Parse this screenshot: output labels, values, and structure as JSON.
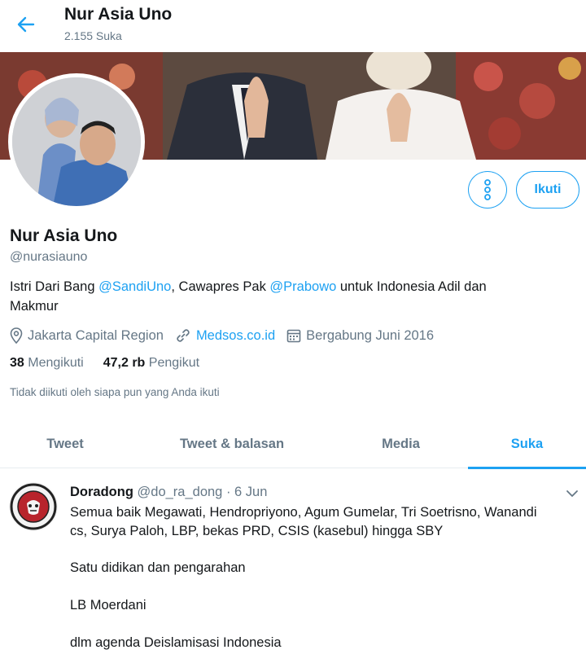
{
  "header": {
    "title": "Nur Asia Uno",
    "subtitle": "2.155 Suka"
  },
  "profile": {
    "follow_label": "Ikuti",
    "display_name": "Nur Asia Uno",
    "handle": "@nurasiauno",
    "bio": {
      "part1": "Istri Dari Bang ",
      "mention1": "@SandiUno",
      "part2": ", Cawapres Pak ",
      "mention2": "@Prabowo",
      "part3": " untuk Indonesia Adil dan",
      "part4": "Makmur"
    },
    "location": "Jakarta Capital Region",
    "website": "Medsos.co.id",
    "joined": "Bergabung Juni 2016",
    "following_count": "38",
    "following_label": "Mengikuti",
    "followers_count": "47,2 rb",
    "followers_label": "Pengikut",
    "not_followed_note": "Tidak diikuti oleh siapa pun yang Anda ikuti"
  },
  "tabs": [
    {
      "label": "Tweet",
      "active": false
    },
    {
      "label": "Tweet & balasan",
      "active": false
    },
    {
      "label": "Media",
      "active": false
    },
    {
      "label": "Suka",
      "active": true
    }
  ],
  "tweet": {
    "author_name": "Doradong",
    "author_handle": "@do_ra_dong",
    "separator": "·",
    "date": "6 Jun",
    "lines": [
      "Semua baik Megawati, Hendropriyono, Agum Gumelar, Tri Soetrisno, Wanandi",
      "cs, Surya Paloh, LBP, bekas PRD, CSIS (kasebul) hingga SBY",
      "Satu didikan dan pengarahan",
      "LB Moerdani",
      "dlm agenda Deislamisasi Indonesia"
    ]
  },
  "icons": {
    "back": "arrow-left-icon",
    "more": "more-vertical-icon",
    "location": "location-pin-icon",
    "link": "link-icon",
    "calendar": "calendar-icon",
    "caret": "chevron-down-icon"
  },
  "colors": {
    "accent": "#1da1f2",
    "text": "#14171a",
    "muted": "#657786",
    "divider": "#e6ecf0"
  }
}
